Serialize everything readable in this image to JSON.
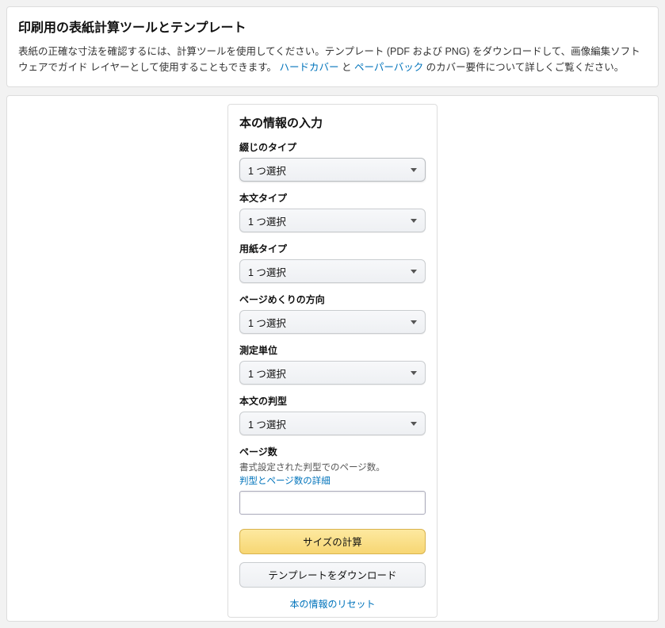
{
  "header": {
    "title": "印刷用の表紙計算ツールとテンプレート",
    "desc_part1": "表紙の正確な寸法を確認するには、計算ツールを使用してください。テンプレート (PDF および PNG) をダウンロードして、画像編集ソフトウェアでガイド レイヤーとして使用することもできます。",
    "link_hardcover": "ハードカバー",
    "and": " と ",
    "link_paperback": "ペーパーバック",
    "desc_part2": " のカバー要件について詳しくご覧ください。"
  },
  "form": {
    "title": "本の情報の入力",
    "select_placeholder": "1 つ選択",
    "fields": {
      "binding": {
        "label": "綴じのタイプ"
      },
      "interior": {
        "label": "本文タイプ"
      },
      "paper": {
        "label": "用紙タイプ"
      },
      "direction": {
        "label": "ページめくりの方向"
      },
      "unit": {
        "label": "測定単位"
      },
      "trim": {
        "label": "本文の判型"
      },
      "pages": {
        "label": "ページ数",
        "subtext": "書式設定された判型でのページ数。",
        "link": "判型とページ数の詳細"
      }
    },
    "buttons": {
      "calc": "サイズの計算",
      "download": "テンプレートをダウンロード",
      "reset": "本の情報のリセット"
    }
  }
}
